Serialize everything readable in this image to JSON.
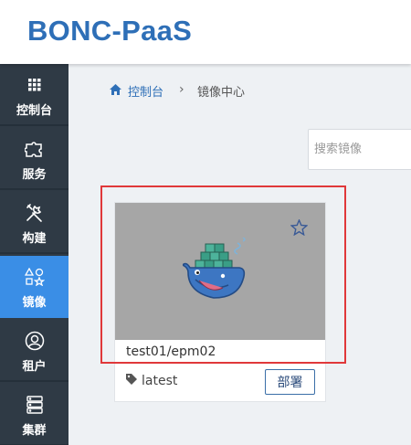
{
  "header": {
    "brand": "BONC-PaaS"
  },
  "sidebar": {
    "items": [
      {
        "label": "控制台",
        "icon": "grid-icon"
      },
      {
        "label": "服务",
        "icon": "puzzle-icon"
      },
      {
        "label": "构建",
        "icon": "tools-icon"
      },
      {
        "label": "镜像",
        "icon": "shapes-icon",
        "active": true
      },
      {
        "label": "租户",
        "icon": "user-circle-icon"
      },
      {
        "label": "集群",
        "icon": "server-icon"
      }
    ]
  },
  "breadcrumb": {
    "home": "控制台",
    "separator": "›",
    "current": "镜像中心"
  },
  "search": {
    "placeholder": "搜索镜像"
  },
  "image_card": {
    "name": "test01/epm02",
    "tag": "latest",
    "deploy_label": "部署",
    "image_bg": "#a6a6a6"
  },
  "colors": {
    "brand": "#2e6fb7",
    "sidebar": "#2f3a45",
    "active": "#3a8ee6",
    "highlight": "#e0383a"
  }
}
